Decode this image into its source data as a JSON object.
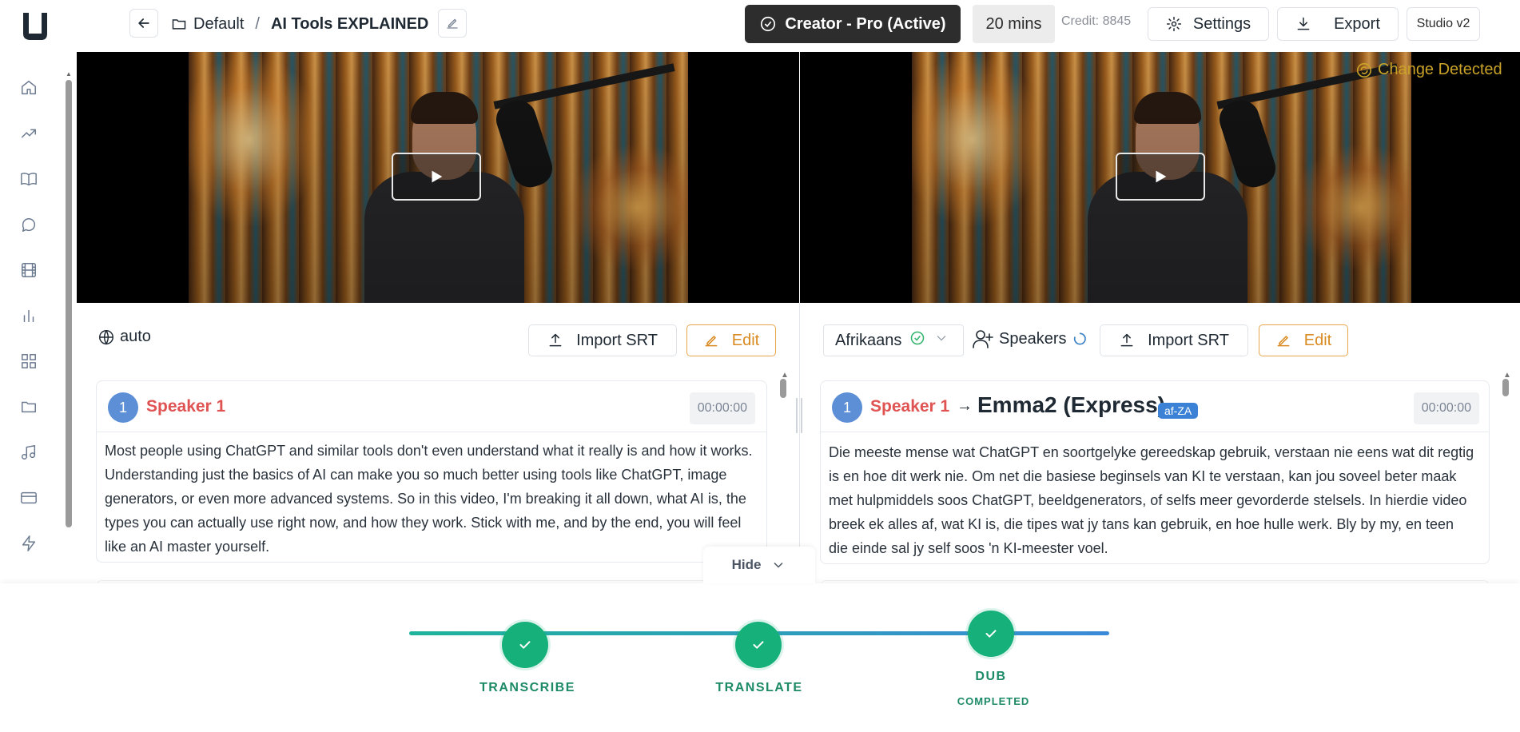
{
  "header": {
    "breadcrumb_folder": "Default",
    "breadcrumb_separator": "/",
    "project_title": "AI Tools EXPLAINED",
    "plan_label": "Creator - Pro (Active)",
    "minutes_label": "20 mins",
    "credit_label": "Credit: 8845",
    "settings_label": "Settings",
    "export_label": "Export",
    "studio_label": "Studio v2"
  },
  "sidebar": {
    "items": [
      {
        "name": "home",
        "icon": "home-icon"
      },
      {
        "name": "trending",
        "icon": "trending-up-icon"
      },
      {
        "name": "library",
        "icon": "book-open-icon"
      },
      {
        "name": "chat",
        "icon": "chat-bubble-icon"
      },
      {
        "name": "videos",
        "icon": "film-icon"
      },
      {
        "name": "analytics",
        "icon": "bar-chart-icon"
      },
      {
        "name": "apps",
        "icon": "grid-icon"
      },
      {
        "name": "files",
        "icon": "folder-icon"
      },
      {
        "name": "audio",
        "icon": "music-note-icon"
      },
      {
        "name": "billing",
        "icon": "credit-card-icon"
      },
      {
        "name": "automation",
        "icon": "lightning-icon"
      }
    ]
  },
  "video_right": {
    "change_detected_label": "Change Detected"
  },
  "left_panel": {
    "language_label": "auto",
    "import_label": "Import SRT",
    "edit_label": "Edit",
    "segments": [
      {
        "speaker_number": "1",
        "speaker_name": "Speaker 1",
        "timecode": "00:00:00",
        "text": "Most people using ChatGPT and similar tools don't even understand what it really is and how it works. Understanding just the basics of AI can make you so much better using tools like ChatGPT, image generators, or even more advanced systems. So in this video, I'm breaking it all down, what AI is, the types you can actually use right now, and how they work. Stick with me, and by the end, you will feel like an AI master yourself."
      }
    ]
  },
  "right_panel": {
    "language_value": "Afrikaans",
    "speakers_label": "Speakers",
    "import_label": "Import SRT",
    "edit_label": "Edit",
    "segments": [
      {
        "speaker_number": "1",
        "speaker_name": "Speaker 1",
        "arrow": "→",
        "voice_name": "Emma2 (Express)",
        "language_code": "af-ZA",
        "timecode": "00:00:00",
        "text": "Die meeste mense wat ChatGPT en soortgelyke gereedskap gebruik, verstaan nie eens wat dit regtig is en hoe dit werk nie. Om net die basiese beginsels van KI te verstaan, kan jou soveel beter maak met hulpmiddels soos ChatGPT, beeldgenerators, of selfs meer gevorderde stelsels. In hierdie video breek ek alles af, wat KI is, die tipes wat jy tans kan gebruik, en hoe hulle werk. Bly by my, en teen die einde sal jy self soos 'n KI-meester voel."
      }
    ]
  },
  "progress": {
    "hide_label": "Hide",
    "steps": [
      {
        "label": "TRANSCRIBE",
        "status": "done"
      },
      {
        "label": "TRANSLATE",
        "status": "done"
      },
      {
        "label": "DUB",
        "status": "done",
        "sub_label": "COMPLETED"
      }
    ],
    "accent_color": "#16b07a",
    "track_gradient": [
      "#1fb39a",
      "#3b8ad8"
    ]
  },
  "colors": {
    "speaker_name": "#e05353",
    "edit_accent": "#d98a20",
    "change_detected": "#c9a227",
    "lang_badge": "#3b82d6"
  }
}
